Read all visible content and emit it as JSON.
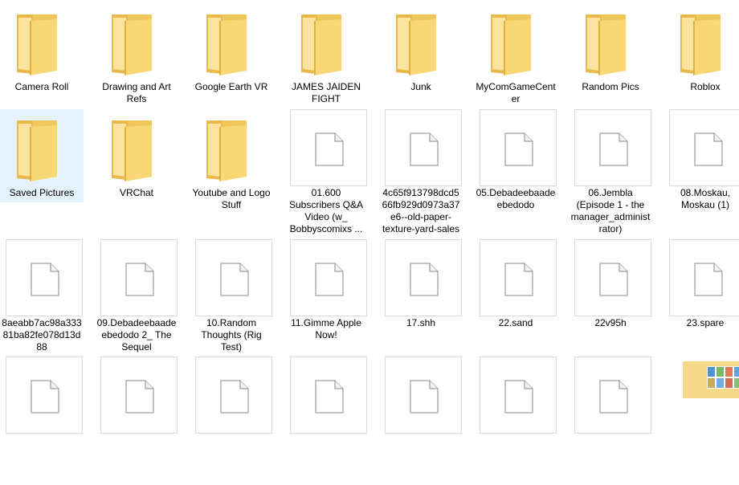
{
  "items": [
    {
      "name": "Camera Roll",
      "type": "folder"
    },
    {
      "name": "Drawing and Art Refs",
      "type": "folder"
    },
    {
      "name": "Google Earth VR",
      "type": "folder"
    },
    {
      "name": "JAMES JAIDEN FIGHT",
      "type": "folder"
    },
    {
      "name": "Junk",
      "type": "folder"
    },
    {
      "name": "MyComGameCenter",
      "type": "folder"
    },
    {
      "name": "Random Pics",
      "type": "folder"
    },
    {
      "name": "Roblox",
      "type": "folder"
    },
    {
      "name": "Saved Pictures",
      "type": "folder",
      "selected": true
    },
    {
      "name": "VRChat",
      "type": "folder"
    },
    {
      "name": "Youtube and Logo Stuff",
      "type": "folder"
    },
    {
      "name": "01.600 Subscribers Q&A Video (w_ Bobbyscomixs ...",
      "type": "file"
    },
    {
      "name": "4c65f913798dcd566fb929d0973a37e6--old-paper-texture-yard-sales",
      "type": "file"
    },
    {
      "name": "05.Debadeebaadeebedodo",
      "type": "file"
    },
    {
      "name": "06.Jembla (Episode 1 - the manager_administrator)",
      "type": "file"
    },
    {
      "name": "08.Moskau, Moskau (1)",
      "type": "file"
    },
    {
      "name": "8aeabb7ac98a33381ba82fe078d13d88",
      "type": "file"
    },
    {
      "name": "09.Debadeebaadeebedodo 2_ The Sequel",
      "type": "file"
    },
    {
      "name": "10.Random Thoughts (Rig Test)",
      "type": "file"
    },
    {
      "name": "11.Gimme Apple Now!",
      "type": "file"
    },
    {
      "name": "17.shh",
      "type": "file"
    },
    {
      "name": "22.sand",
      "type": "file"
    },
    {
      "name": "22v95h",
      "type": "file"
    },
    {
      "name": "23.spare",
      "type": "file"
    },
    {
      "name": "",
      "type": "file"
    },
    {
      "name": "",
      "type": "file"
    },
    {
      "name": "",
      "type": "file"
    },
    {
      "name": "",
      "type": "file"
    },
    {
      "name": "",
      "type": "file"
    },
    {
      "name": "",
      "type": "file"
    },
    {
      "name": "",
      "type": "file"
    },
    {
      "name": "",
      "type": "image"
    }
  ]
}
